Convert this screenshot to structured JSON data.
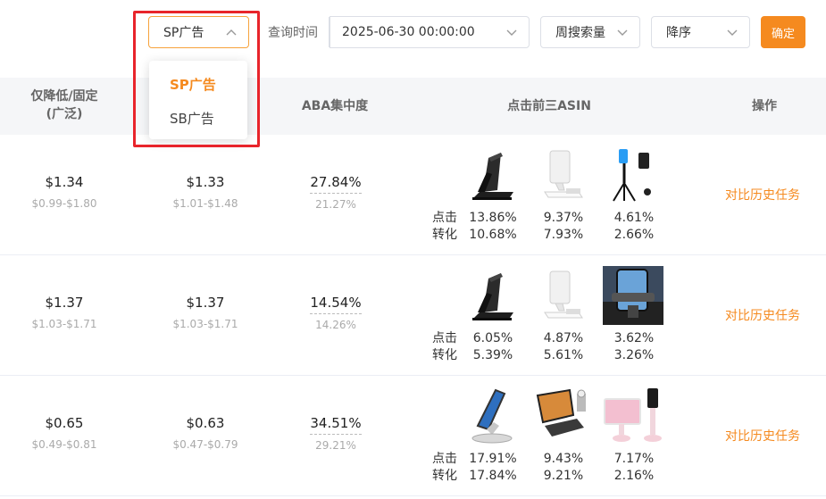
{
  "toolbar": {
    "ad_type": "SP广告",
    "query_label": "查询时间",
    "date": "2025-06-30 00:00:00",
    "metric": "周搜索量",
    "order": "降序",
    "confirm": "确定"
  },
  "dropdown": {
    "options": [
      "SP广告",
      "SB广告"
    ],
    "selected": "SP广告"
  },
  "header": {
    "bid_line1": "仅降低/固定",
    "bid_line2": "(广泛)",
    "aba": "ABA集中度",
    "top3": "点击前三ASIN",
    "action": "操作"
  },
  "labels": {
    "click": "点击",
    "conversion": "转化"
  },
  "rows": [
    {
      "bid1": "$1.34",
      "bid1_range": "$0.99-$1.80",
      "bid2": "$1.33",
      "bid2_range": "$1.01-$1.48",
      "aba_top": "27.84%",
      "aba_bottom": "21.27%",
      "asins": [
        {
          "click": "13.86%",
          "conv": "10.68%",
          "icon": "black-foldable-stand"
        },
        {
          "click": "9.37%",
          "conv": "7.93%",
          "icon": "white-phone-stand"
        },
        {
          "click": "4.61%",
          "conv": "2.66%",
          "icon": "tripod-stand"
        }
      ],
      "action": "对比历史任务"
    },
    {
      "bid1": "$1.37",
      "bid1_range": "$1.03-$1.71",
      "bid2": "$1.37",
      "bid2_range": "$1.03-$1.71",
      "aba_top": "14.54%",
      "aba_bottom": "14.26%",
      "asins": [
        {
          "click": "6.05%",
          "conv": "5.39%",
          "icon": "black-foldable-stand"
        },
        {
          "click": "4.87%",
          "conv": "5.61%",
          "icon": "white-phone-stand"
        },
        {
          "click": "3.62%",
          "conv": "3.26%",
          "icon": "car-vent-mount"
        }
      ],
      "action": "对比历史任务"
    },
    {
      "bid1": "$0.65",
      "bid1_range": "$0.49-$0.81",
      "bid2": "$0.63",
      "bid2_range": "$0.47-$0.79",
      "aba_top": "34.51%",
      "aba_bottom": "29.21%",
      "asins": [
        {
          "click": "17.91%",
          "conv": "17.84%",
          "icon": "silver-tablet-stand"
        },
        {
          "click": "9.43%",
          "conv": "9.21%",
          "icon": "tablet-desk-stand"
        },
        {
          "click": "7.17%",
          "conv": "2.16%",
          "icon": "pink-tablet-stand"
        }
      ],
      "action": "对比历史任务"
    }
  ],
  "colors": {
    "accent": "#f58a1f",
    "highlight": "#e8242b"
  }
}
